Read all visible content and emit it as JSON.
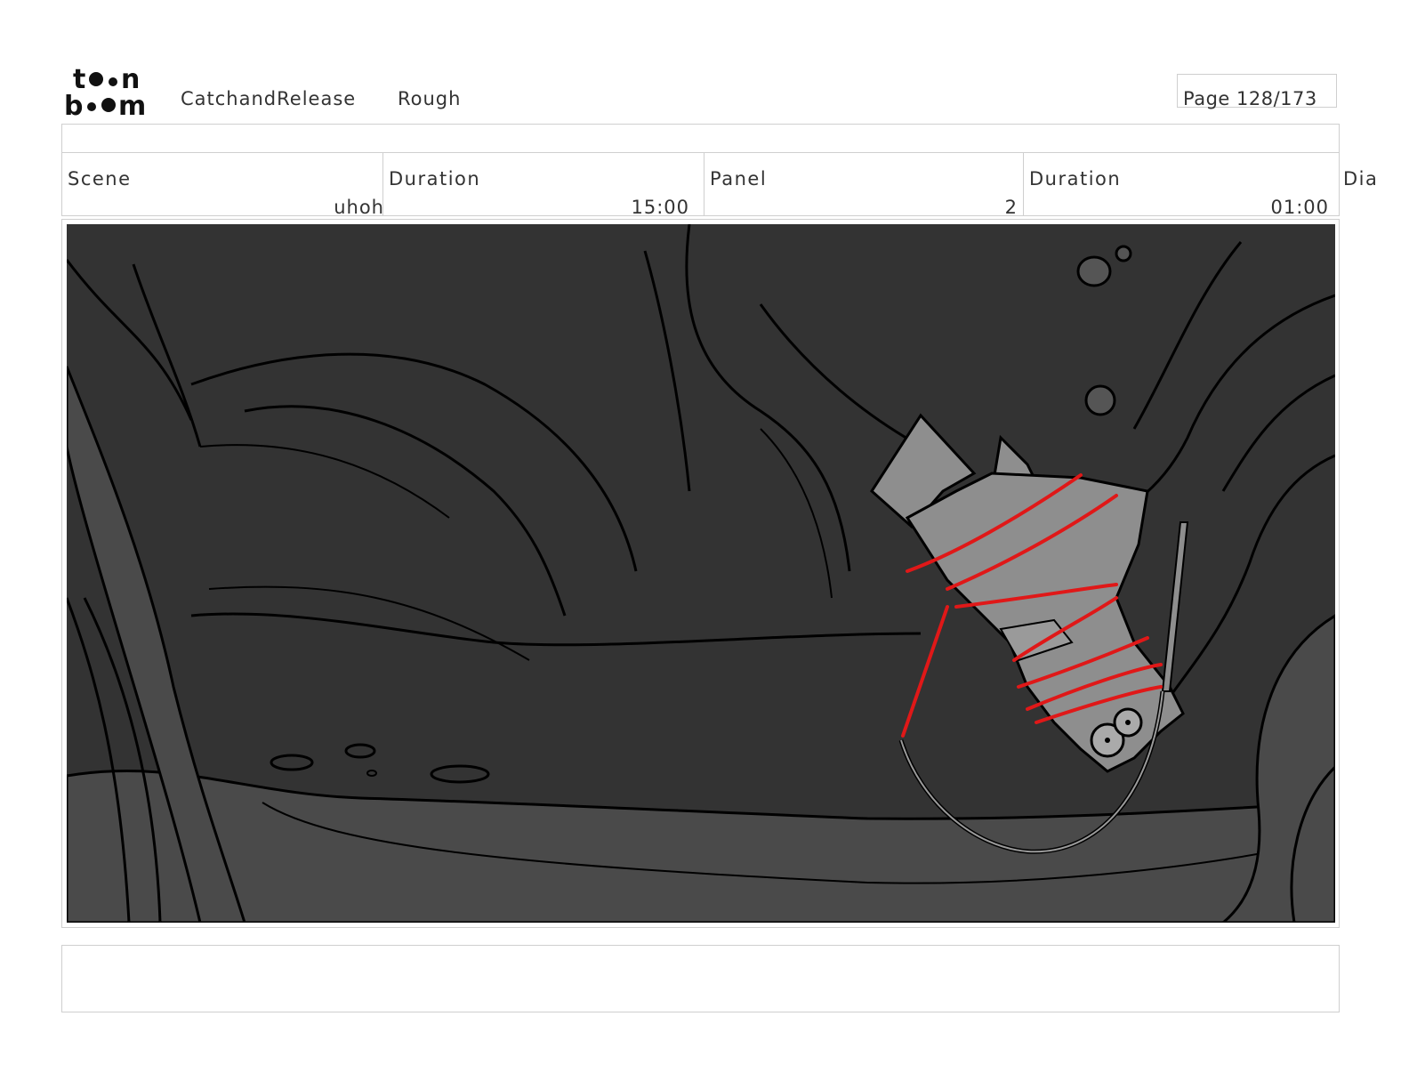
{
  "header": {
    "logo_text": "toon boom",
    "project": "CatchandRelease",
    "stage": "Rough",
    "page": "Page 128/173"
  },
  "info": {
    "scene_label": "Scene",
    "scene_value": "uhoh",
    "scene_duration_label": "Duration",
    "scene_duration_value": "15:00",
    "panel_label": "Panel",
    "panel_value": "2",
    "panel_duration_label": "Duration",
    "panel_duration_value": "01:00",
    "dialogue_label": "Dia"
  },
  "colors": {
    "background": "#333333",
    "floor": "#4a4a4a",
    "character": "#8e8e8e",
    "rope": "#e01818",
    "line": "#000000"
  },
  "notes": ""
}
